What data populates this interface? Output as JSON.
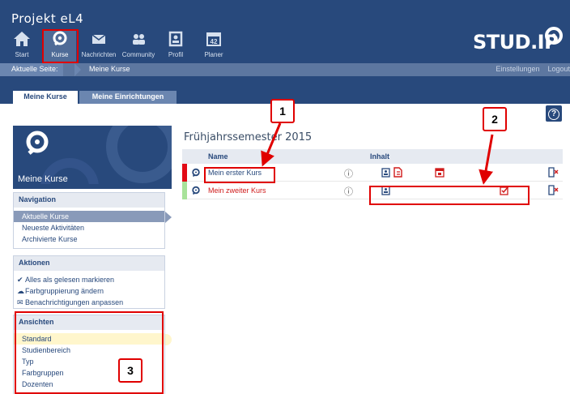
{
  "header": {
    "project_title": "Projekt eL4",
    "logo_text": "STUD.IP",
    "nav": [
      {
        "id": "start",
        "label": "Start",
        "icon": "home-icon"
      },
      {
        "id": "kurse",
        "label": "Kurse",
        "icon": "courses-icon"
      },
      {
        "id": "nachrichten",
        "label": "Nachrichten",
        "icon": "envelope-icon"
      },
      {
        "id": "community",
        "label": "Community",
        "icon": "people-icon"
      },
      {
        "id": "profil",
        "label": "Profil",
        "icon": "profile-icon"
      },
      {
        "id": "planer",
        "label": "Planer",
        "icon": "calendar-icon",
        "badge": "42"
      }
    ]
  },
  "breadcrumb": {
    "label": "Aktuelle Seite:",
    "page": "Meine Kurse",
    "links": [
      "Einstellungen",
      "Logout"
    ]
  },
  "tabs": [
    "Meine Kurse",
    "Meine Einrichtungen"
  ],
  "help": {
    "icon": "help-icon",
    "glyph": "?"
  },
  "sidebar": {
    "title": "Meine Kurse",
    "navigation": {
      "title": "Navigation",
      "items": [
        "Aktuelle Kurse",
        "Neueste Aktivitäten",
        "Archivierte Kurse"
      ]
    },
    "actions": {
      "title": "Aktionen",
      "items": [
        {
          "label": "Alles als gelesen markieren",
          "icon": "check-icon"
        },
        {
          "label": "Farbgruppierung ändern",
          "icon": "color-group-icon"
        },
        {
          "label": "Benachrichtigungen anpassen",
          "icon": "envelope-icon"
        }
      ]
    },
    "views": {
      "title": "Ansichten",
      "items": [
        "Standard",
        "Studienbereich",
        "Typ",
        "Farbgruppen",
        "Dozenten"
      ]
    }
  },
  "main": {
    "semester": "Frühjahrssemester 2015",
    "columns": {
      "name": "Name",
      "content": "Inhalt"
    },
    "courses": [
      {
        "name": "Mein erster Kurs",
        "color": "#e20a16"
      },
      {
        "name": "Mein zweiter Kurs",
        "color": "#a8e39a"
      }
    ]
  },
  "callouts": [
    "1",
    "2",
    "3"
  ],
  "colors": {
    "primary": "#28497c",
    "breadcrumb": "#5d77a0",
    "annotation": "#e00000",
    "alert_red": "#d01b1b"
  }
}
